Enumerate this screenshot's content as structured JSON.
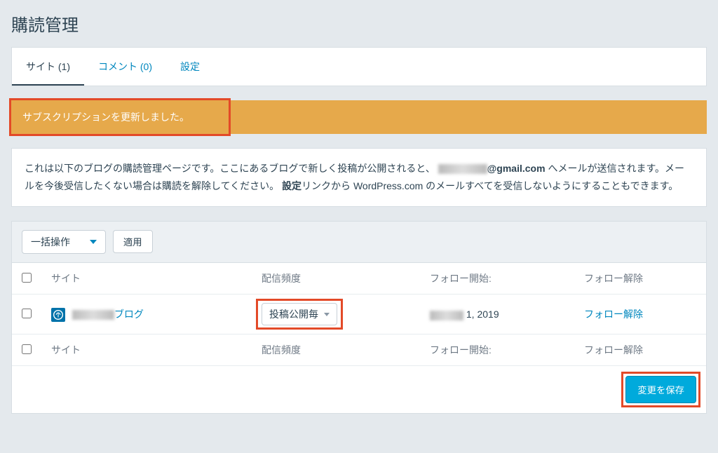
{
  "page_title": "購読管理",
  "tabs": {
    "sites": "サイト (1)",
    "comments": "コメント (0)",
    "settings": "設定"
  },
  "notice": "サブスクリプションを更新しました。",
  "description": {
    "part1": "これは以下のブログの購読管理ページです。ここにあるブログで新しく投稿が公開されると、",
    "email_suffix": "@gmail.com",
    "part2": " へメールが送信されます。メールを今後受信したくない場合は購読を解除してください。",
    "settings_bold": "設定",
    "part3": "リンクから WordPress.com のメールすべてを受信しないようにすることもできます。"
  },
  "bulk": {
    "placeholder": "一括操作",
    "apply": "適用"
  },
  "columns": {
    "site": "サイト",
    "frequency": "配信頻度",
    "followed": "フォロー開始:",
    "unfollow": "フォロー解除"
  },
  "row": {
    "site_name_suffix": "ブログ",
    "frequency_value": "投稿公開毎",
    "followed_date_suffix": " 1, 2019",
    "unfollow_label": "フォロー解除"
  },
  "save_button": "変更を保存"
}
